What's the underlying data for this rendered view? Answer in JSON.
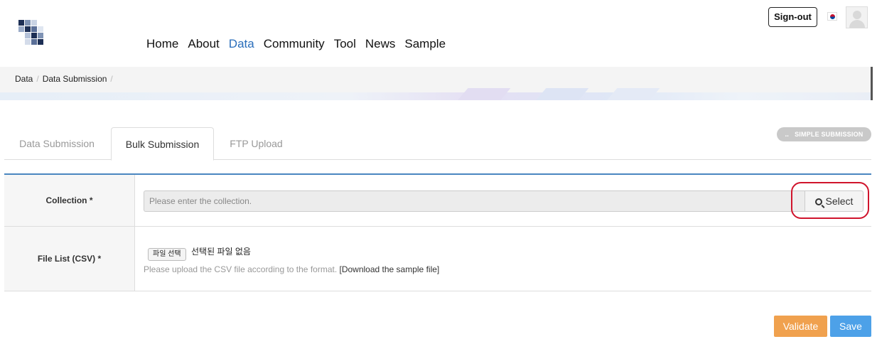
{
  "nav": {
    "items": [
      {
        "label": "Home",
        "active": false
      },
      {
        "label": "About",
        "active": false
      },
      {
        "label": "Data",
        "active": true
      },
      {
        "label": "Community",
        "active": false
      },
      {
        "label": "Tool",
        "active": false
      },
      {
        "label": "News",
        "active": false
      },
      {
        "label": "Sample",
        "active": false
      }
    ],
    "signout_label": "Sign-out",
    "language_icon": "korea-flag-icon",
    "avatar_icon": "user-avatar-icon"
  },
  "breadcrumb": {
    "items": [
      "Data",
      "Data Submission"
    ],
    "separator": "/"
  },
  "tabs": {
    "items": [
      {
        "label": "Data Submission",
        "active": false
      },
      {
        "label": "Bulk Submission",
        "active": true
      },
      {
        "label": "FTP Upload",
        "active": false
      }
    ],
    "simple_submission_label": "SIMPLE SUBMISSION"
  },
  "form": {
    "collection": {
      "label": "Collection *",
      "placeholder": "Please enter the collection.",
      "select_label": "Select",
      "select_icon": "search-icon"
    },
    "file_list": {
      "label": "File List (CSV) *",
      "choose_file_label": "파일 선택",
      "no_file_text": "선택된 파일 없음",
      "help_text": "Please upload the CSV file according to the format.",
      "sample_link_text": "[Download the sample file]"
    }
  },
  "actions": {
    "validate_label": "Validate",
    "save_label": "Save"
  },
  "colors": {
    "accent_blue": "#2a6ebb",
    "table_top_border": "#4a86c0",
    "validate_orange": "#f0a14e",
    "save_blue": "#4da1e8",
    "highlight_red": "#d0142c"
  }
}
